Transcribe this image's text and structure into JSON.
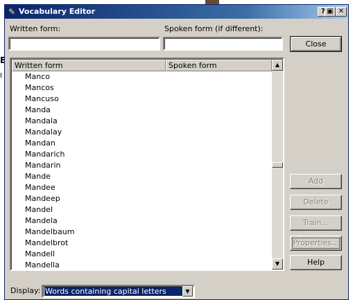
{
  "window": {
    "title": "Vocabulary Editor",
    "icon": "pencil-icon",
    "title_buttons": {
      "help": "?",
      "restore": "▣",
      "close": "✕"
    }
  },
  "written_form": {
    "label": "Written form:",
    "value": ""
  },
  "spoken_form": {
    "label": "Spoken form (if different):",
    "value": ""
  },
  "list": {
    "columns": [
      "Written form",
      "Spoken form"
    ],
    "rows": [
      "Manco",
      "Mancos",
      "Mancuso",
      "Manda",
      "Mandala",
      "Mandalay",
      "Mandan",
      "Mandarich",
      "Mandarin",
      "Mande",
      "Mandee",
      "Mandeep",
      "Mandel",
      "Mandela",
      "Mandelbaum",
      "Mandelbrot",
      "Mandell",
      "Mandella"
    ],
    "scroll_position": 0.5
  },
  "buttons": {
    "close": "Close",
    "add": "Add",
    "delete": "Delete",
    "train": "Train...",
    "properties": "Properties...",
    "help": "Help"
  },
  "display": {
    "label": "Display:",
    "selected": "Words containing capital letters"
  },
  "colors": {
    "titlebar": "#0a246a",
    "face": "#d4d0c8",
    "selection": "#0a246a"
  }
}
